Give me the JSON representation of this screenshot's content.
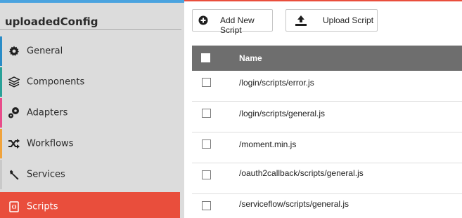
{
  "sidebar": {
    "title": "uploadedConfig",
    "items": [
      {
        "label": "General",
        "icon": "gear-icon",
        "color": "#2a8cc7"
      },
      {
        "label": "Components",
        "icon": "layers-icon",
        "color": "#2aa198"
      },
      {
        "label": "Adapters",
        "icon": "gears-icon",
        "color": "#e84c8a"
      },
      {
        "label": "Workflows",
        "icon": "shuffle-icon",
        "color": "#f0a33c"
      },
      {
        "label": "Services",
        "icon": "wrench-icon",
        "color": "#c9c9c9"
      },
      {
        "label": "Scripts",
        "icon": "script-file-icon",
        "color": "#e94e3c",
        "active": true
      }
    ]
  },
  "toolbar": {
    "add_label": "Add New Script",
    "upload_label": "Upload Script"
  },
  "table": {
    "header": "Name",
    "rows": [
      "/login/scripts/error.js",
      "/login/scripts/general.js",
      "/moment.min.js",
      "/oauth2callback/scripts/general.js",
      "/serviceflow/scripts/general.js"
    ]
  },
  "colors": {
    "accent": "#e94e3c",
    "top_bar": "#4aa3df",
    "header_bg": "#6e6e6e"
  }
}
